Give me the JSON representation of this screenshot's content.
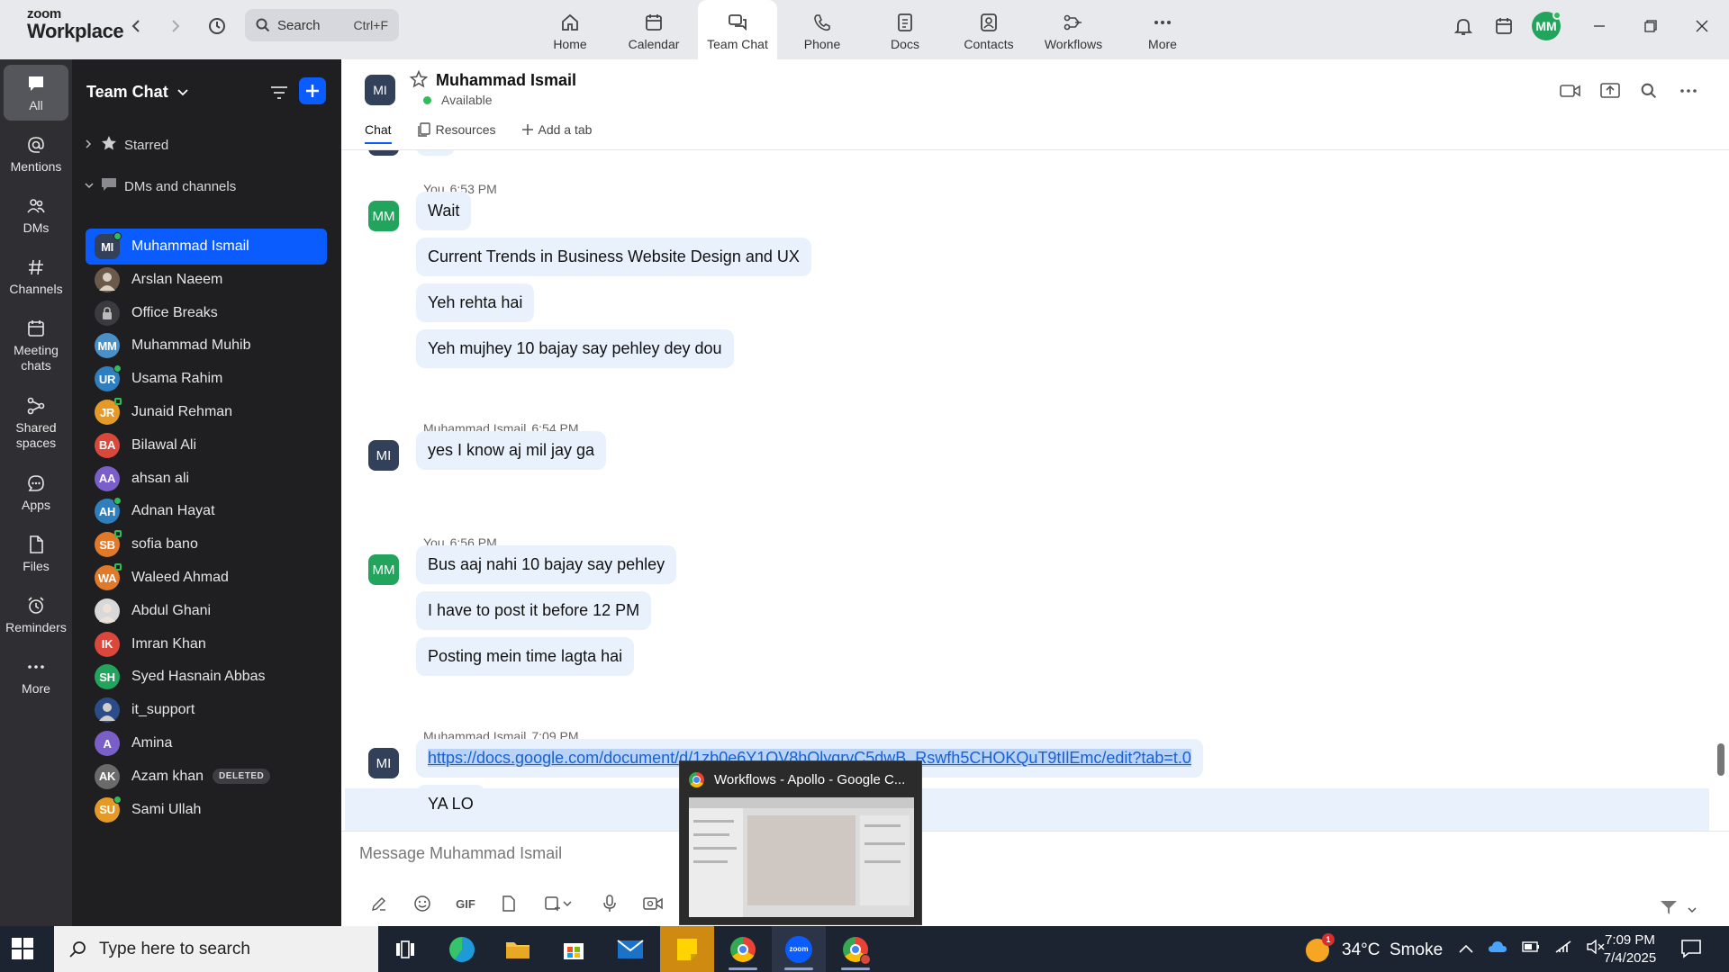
{
  "app": {
    "logo_line1": "zoom",
    "logo_line2": "Workplace"
  },
  "search": {
    "label": "Search",
    "shortcut": "Ctrl+F"
  },
  "nav_tabs": [
    {
      "label": "Home",
      "icon": "home-icon"
    },
    {
      "label": "Calendar",
      "icon": "calendar-icon"
    },
    {
      "label": "Team Chat",
      "icon": "chat-icon",
      "active": true
    },
    {
      "label": "Phone",
      "icon": "phone-icon"
    },
    {
      "label": "Docs",
      "icon": "docs-icon"
    },
    {
      "label": "Contacts",
      "icon": "contacts-icon"
    },
    {
      "label": "Workflows",
      "icon": "workflows-icon"
    },
    {
      "label": "More",
      "icon": "more-icon"
    }
  ],
  "profile": {
    "initials": "MM",
    "color": "#22a45d"
  },
  "rail": [
    {
      "label": "All",
      "icon": "chat-bubble-icon",
      "active": true
    },
    {
      "label": "Mentions",
      "icon": "at-icon"
    },
    {
      "label": "DMs",
      "icon": "people-icon"
    },
    {
      "label": "Channels",
      "icon": "hash-icon"
    },
    {
      "label": "Meeting",
      "label2": "chats",
      "icon": "meeting-calendar-icon"
    },
    {
      "label": "Shared",
      "label2": "spaces",
      "icon": "shared-spaces-icon"
    },
    {
      "label": "Apps",
      "icon": "apps-icon"
    },
    {
      "label": "Files",
      "icon": "file-icon"
    },
    {
      "label": "Reminders",
      "icon": "alarm-icon"
    },
    {
      "label": "More",
      "icon": "more-icon"
    }
  ],
  "sidebar": {
    "title": "Team Chat",
    "sections": [
      {
        "label": "Starred"
      },
      {
        "label": "DMs and channels"
      }
    ],
    "conversations": [
      {
        "name": "Muhammad Ismail",
        "initials": "MI",
        "color": "#33405a",
        "presence": "online",
        "active": true
      },
      {
        "name": "Arslan Naeem",
        "initials": "",
        "color": "#6b5a4a",
        "presence": "none",
        "photo": true
      },
      {
        "name": "Office Breaks",
        "initials": "",
        "color": "#3a3a3f",
        "presence": "none",
        "lock": true
      },
      {
        "name": "Muhammad Muhib",
        "initials": "MM",
        "color": "#4a90c8",
        "presence": "none"
      },
      {
        "name": "Usama Rahim",
        "initials": "UR",
        "color": "#2f7fbf",
        "presence": "online"
      },
      {
        "name": "Junaid Rehman",
        "initials": "JR",
        "color": "#e59a28",
        "presence": "away"
      },
      {
        "name": "Bilawal Ali",
        "initials": "BA",
        "color": "#d9483b",
        "presence": "none"
      },
      {
        "name": "ahsan ali",
        "initials": "AA",
        "color": "#7b5fc9",
        "presence": "none"
      },
      {
        "name": "Adnan Hayat",
        "initials": "AH",
        "color": "#2f7fbf",
        "presence": "online"
      },
      {
        "name": "sofia bano",
        "initials": "SB",
        "color": "#e07a2a",
        "presence": "away"
      },
      {
        "name": "Waleed Ahmad",
        "initials": "WA",
        "color": "#e07a2a",
        "presence": "away"
      },
      {
        "name": "Abdul Ghani",
        "initials": "",
        "color": "#d8d8d8",
        "presence": "none",
        "photo": true
      },
      {
        "name": "Imran Khan",
        "initials": "IK",
        "color": "#d9483b",
        "presence": "none"
      },
      {
        "name": "Syed Hasnain Abbas",
        "initials": "SH",
        "color": "#22a45d",
        "presence": "none"
      },
      {
        "name": "it_support",
        "initials": "",
        "color": "#2a4d8a",
        "presence": "none",
        "photo": true
      },
      {
        "name": "Amina",
        "initials": "A",
        "color": "#7b5fc9",
        "presence": "none"
      },
      {
        "name": "Azam khan",
        "initials": "AK",
        "color": "#6a6a6a",
        "presence": "none",
        "badge": "DELETED"
      },
      {
        "name": "Sami Ullah",
        "initials": "SU",
        "color": "#e59a28",
        "presence": "online"
      }
    ]
  },
  "chat": {
    "contact_initials": "MI",
    "contact_name": "Muhammad Ismail",
    "status": "Available",
    "tabs": [
      {
        "label": "Chat",
        "active": true
      },
      {
        "label": "Resources",
        "icon": "resources-icon"
      },
      {
        "label": "Add a tab",
        "icon": "plus-icon"
      }
    ],
    "partial_top": "ok",
    "groups": [
      {
        "sender": "You",
        "time": "6:53 PM",
        "initials": "MM",
        "color": "#22a45d",
        "messages": [
          "Wait",
          "Current Trends in Business Website Design and UX",
          "Yeh rehta hai",
          "Yeh mujhey 10 bajay say pehley dey dou"
        ]
      },
      {
        "sender": "Muhammad Ismail",
        "time": "6:54 PM",
        "initials": "MI",
        "color": "#33405a",
        "messages": [
          "yes I know aj mil jay ga"
        ]
      },
      {
        "sender": "You",
        "time": "6:56 PM",
        "initials": "MM",
        "color": "#22a45d",
        "messages": [
          "Bus aaj nahi 10 bajay say pehley",
          "I have to post it before 12 PM",
          "Posting mein time lagta hai"
        ]
      },
      {
        "sender": "Muhammad Ismail",
        "time": "7:09 PM",
        "initials": "MI",
        "color": "#33405a",
        "messages": [
          "https://docs.google.com/document/d/1zb0e6Y1OV8hQlyqrvC5dwB_Rswfh5CHOKQuT9tIlEmc/edit?tab=t.0",
          "YA LO"
        ]
      }
    ],
    "composer_placeholder": "Message Muhammad Ismail",
    "composer_gif": "GIF"
  },
  "popup": {
    "title": "Workflows - Apollo - Google C..."
  },
  "taskbar": {
    "search_placeholder": "Type here to search",
    "weather": "34°C  Smoke",
    "weather_badge": "1",
    "time": "7:09 PM",
    "date": "7/4/2025"
  }
}
